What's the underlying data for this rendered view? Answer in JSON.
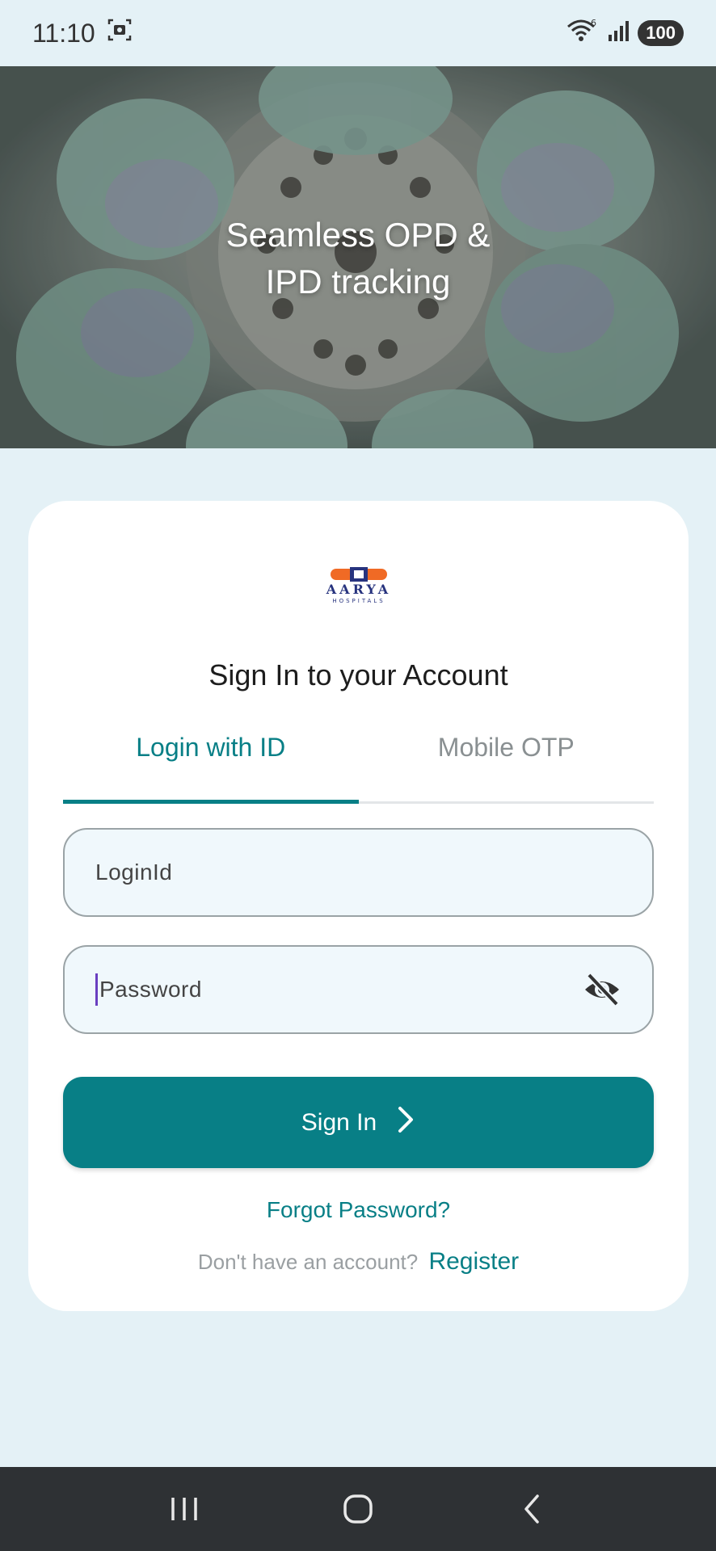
{
  "status_bar": {
    "time": "11:10",
    "wifi_badge": "6",
    "battery": "100",
    "icons": [
      "screenshot-icon",
      "wifi-icon",
      "signal-icon",
      "battery-icon"
    ]
  },
  "hero": {
    "title": "Seamless OPD &\nIPD tracking"
  },
  "logo": {
    "brand": "AARYA",
    "sub": "HOSPITALS",
    "colors": {
      "orange": "#f06a25",
      "navy": "#27337e"
    }
  },
  "card": {
    "title": "Sign In to your Account"
  },
  "tabs": [
    {
      "label": "Login with ID",
      "active": true
    },
    {
      "label": "Mobile OTP",
      "active": false
    }
  ],
  "form": {
    "login_placeholder": "LoginId",
    "password_placeholder": "Password",
    "signin_label": "Sign In",
    "forgot_label": "Forgot Password?",
    "register_prompt": "Don't have an account?",
    "register_label": "Register"
  },
  "colors": {
    "accent": "#087f86",
    "background": "#e4f1f6",
    "navbar": "#2e3134"
  },
  "nav_bar": {
    "icons": [
      "recent-apps-icon",
      "home-icon",
      "back-icon"
    ]
  }
}
